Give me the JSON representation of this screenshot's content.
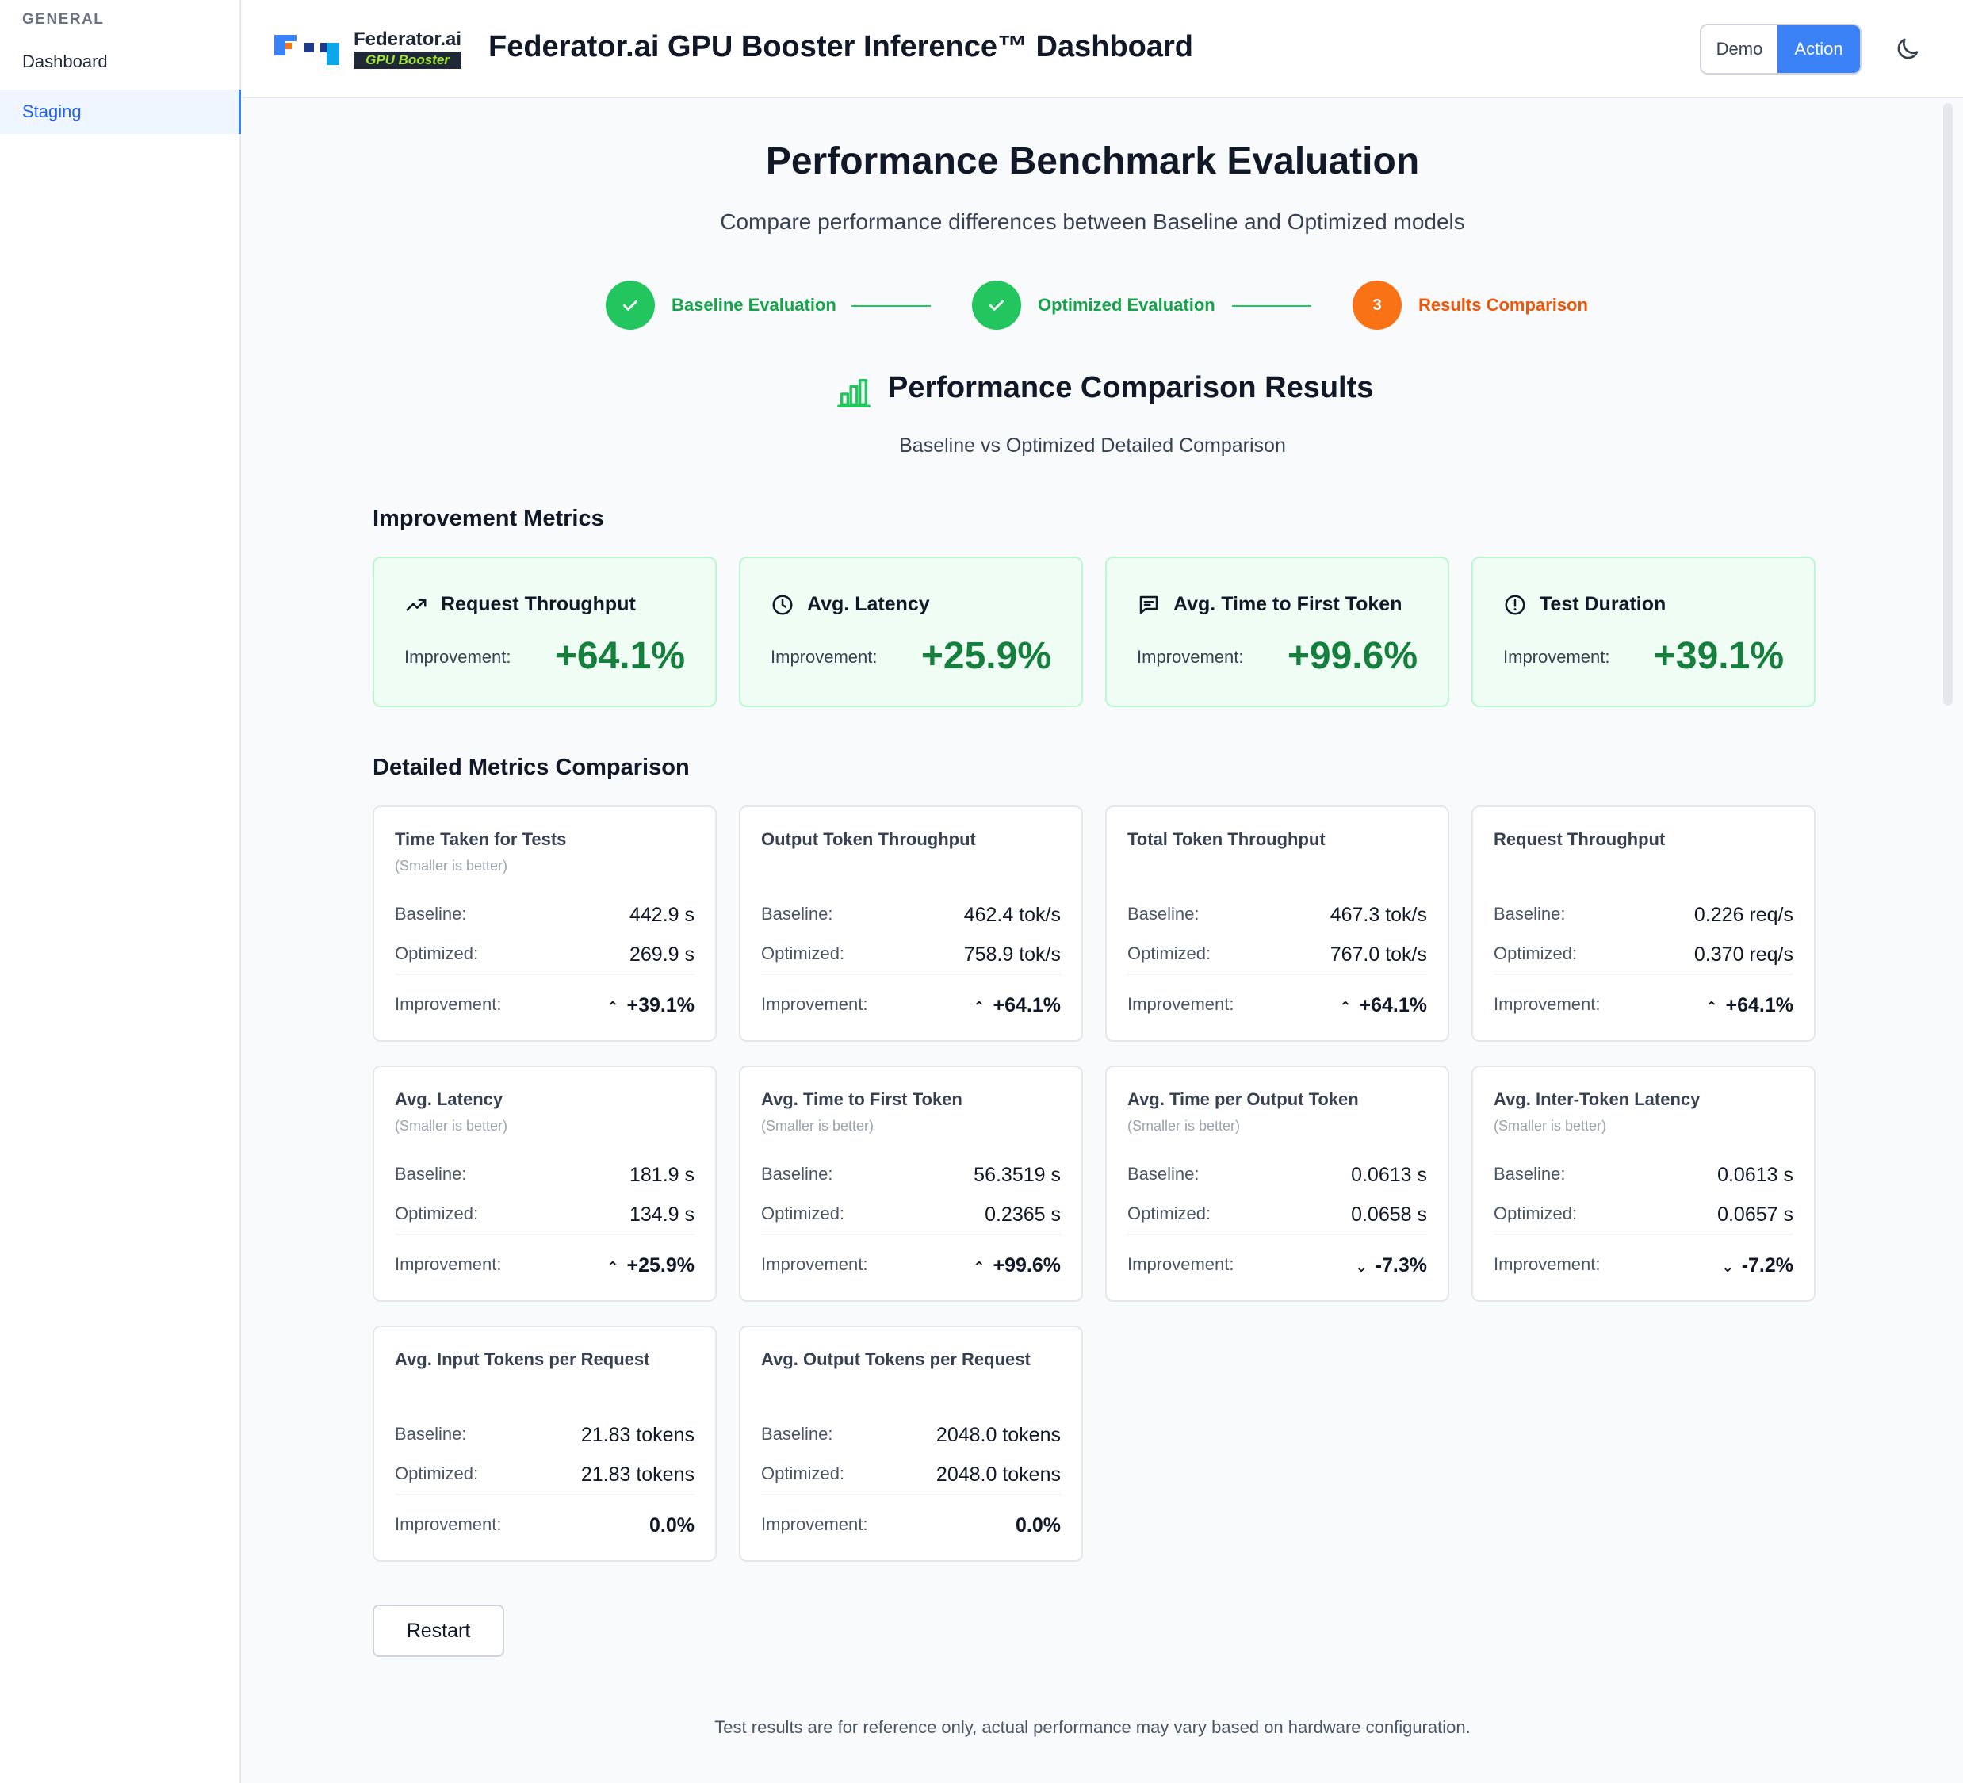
{
  "sidebar": {
    "section": "GENERAL",
    "items": [
      {
        "label": "Dashboard"
      },
      {
        "label": "Staging"
      }
    ]
  },
  "header": {
    "logo_line1": "Federator.ai",
    "logo_line2": "GPU Booster",
    "title": "Federator.ai GPU Booster Inference™ Dashboard",
    "demo_label": "Demo",
    "action_label": "Action"
  },
  "page": {
    "title": "Performance Benchmark Evaluation",
    "subtitle": "Compare performance differences between Baseline and Optimized models"
  },
  "steps": [
    {
      "label": "Baseline Evaluation",
      "status": "done"
    },
    {
      "label": "Optimized Evaluation",
      "status": "done"
    },
    {
      "number": "3",
      "label": "Results Comparison",
      "status": "current"
    }
  ],
  "results": {
    "title": "Performance Comparison Results",
    "subtitle": "Baseline vs Optimized Detailed Comparison"
  },
  "improvement_section": "Improvement Metrics",
  "improvement_label": "Improvement:",
  "improvements": [
    {
      "icon": "trending-up-icon",
      "title": "Request Throughput",
      "value": "+64.1%"
    },
    {
      "icon": "clock-icon",
      "title": "Avg. Latency",
      "value": "+25.9%"
    },
    {
      "icon": "message-icon",
      "title": "Avg. Time to First Token",
      "value": "+99.6%"
    },
    {
      "icon": "alert-circle-icon",
      "title": "Test Duration",
      "value": "+39.1%"
    }
  ],
  "detail_section": "Detailed Metrics Comparison",
  "row_labels": {
    "baseline": "Baseline:",
    "optimized": "Optimized:",
    "improvement": "Improvement:"
  },
  "details": [
    {
      "title": "Time Taken for Tests",
      "note": "(Smaller is better)",
      "baseline": "442.9 s",
      "optimized": "269.9 s",
      "improvement": "+39.1%",
      "trend": "up"
    },
    {
      "title": "Output Token Throughput",
      "note": "",
      "baseline": "462.4 tok/s",
      "optimized": "758.9 tok/s",
      "improvement": "+64.1%",
      "trend": "up"
    },
    {
      "title": "Total Token Throughput",
      "note": "",
      "baseline": "467.3 tok/s",
      "optimized": "767.0 tok/s",
      "improvement": "+64.1%",
      "trend": "up"
    },
    {
      "title": "Request Throughput",
      "note": "",
      "baseline": "0.226 req/s",
      "optimized": "0.370 req/s",
      "improvement": "+64.1%",
      "trend": "up"
    },
    {
      "title": "Avg. Latency",
      "note": "(Smaller is better)",
      "baseline": "181.9 s",
      "optimized": "134.9 s",
      "improvement": "+25.9%",
      "trend": "up"
    },
    {
      "title": "Avg. Time to First Token",
      "note": "(Smaller is better)",
      "baseline": "56.3519 s",
      "optimized": "0.2365 s",
      "improvement": "+99.6%",
      "trend": "up"
    },
    {
      "title": "Avg. Time per Output Token",
      "note": "(Smaller is better)",
      "baseline": "0.0613 s",
      "optimized": "0.0658 s",
      "improvement": "-7.3%",
      "trend": "down"
    },
    {
      "title": "Avg. Inter-Token Latency",
      "note": "(Smaller is better)",
      "baseline": "0.0613 s",
      "optimized": "0.0657 s",
      "improvement": "-7.2%",
      "trend": "down"
    },
    {
      "title": "Avg. Input Tokens per Request",
      "note": "",
      "baseline": "21.83 tokens",
      "optimized": "21.83 tokens",
      "improvement": "0.0%",
      "trend": "neutral"
    },
    {
      "title": "Avg. Output Tokens per Request",
      "note": "",
      "baseline": "2048.0 tokens",
      "optimized": "2048.0 tokens",
      "improvement": "0.0%",
      "trend": "neutral"
    }
  ],
  "restart_label": "Restart",
  "footer": "Test results are for reference only, actual performance may vary based on hardware configuration.",
  "colors": {
    "accent": "#3b82f6",
    "success": "#22c55e",
    "current_step": "#f97316",
    "negative": "#dc2626"
  }
}
